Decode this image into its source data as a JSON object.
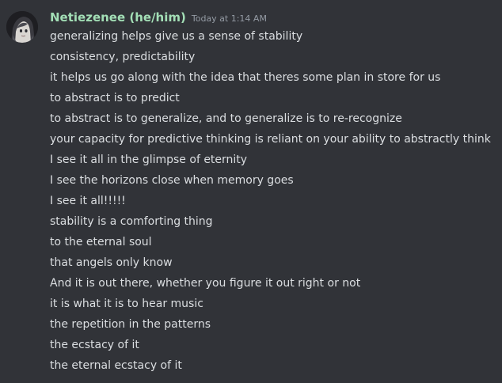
{
  "message": {
    "author": "Netiezenee (he/him)",
    "timestamp": "Today at 1:14 AM",
    "lines": [
      "generalizing helps give us a sense of stability",
      "consistency, predictability",
      "it helps us go along with the idea that theres some plan in store for us",
      "to abstract is to predict",
      "to abstract is to generalize, and to generalize is to re-recognize",
      "your capacity for predictive thinking is reliant on your ability to abstractly think",
      "I see it all in the glimpse of eternity",
      "I see the horizons close when memory goes",
      "I see it all!!!!!",
      "stability is a comforting thing",
      "to the eternal soul",
      "that angels only know",
      "And it is out there, whether you figure it out right or not",
      "it is what it is to hear music",
      "the repetition in the patterns",
      "the ecstacy of it",
      "the eternal ecstacy of it"
    ]
  },
  "colors": {
    "background": "#313338",
    "username": "#a3dfb6",
    "timestamp": "#949ba4",
    "text": "#dbdee1"
  },
  "icons": {
    "avatar": "user-avatar"
  }
}
